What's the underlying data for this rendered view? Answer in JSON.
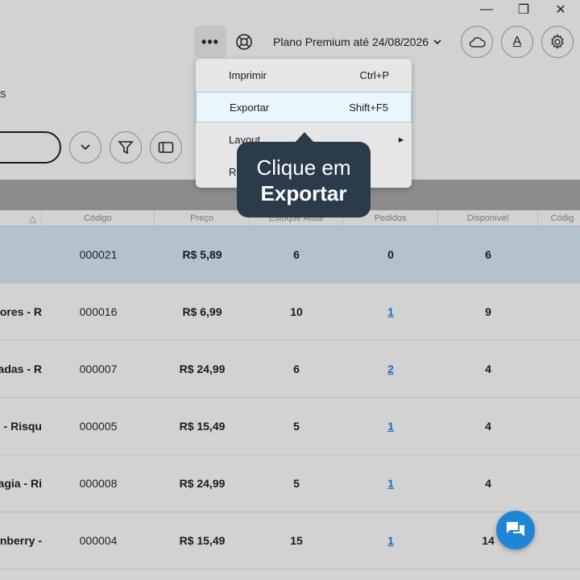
{
  "window": {
    "minimize_glyph": "—",
    "maximize_glyph": "❐",
    "close_glyph": "✕"
  },
  "topbar": {
    "more_glyph": "•••",
    "plan_text": "Plano Premium até 24/08/2026",
    "font_button_label": "A"
  },
  "toolbar": {
    "partial_label": "s"
  },
  "menu": {
    "items": [
      {
        "label": "Imprimir",
        "shortcut": "Ctrl+P"
      },
      {
        "label": "Exportar",
        "shortcut": "Shift+F5"
      },
      {
        "label": "Layout",
        "shortcut": ""
      },
      {
        "label": "Re",
        "shortcut": ""
      }
    ]
  },
  "tooltip": {
    "line1": "Clique em",
    "line2": "Exportar"
  },
  "table": {
    "sort_glyph": "△",
    "headers": [
      "Código",
      "Preço",
      "Estoque Atual",
      "Pedidos",
      "Disponível",
      "Códig"
    ],
    "rows": [
      {
        "name": "",
        "code": "000021",
        "price": "R$ 5,89",
        "stock": "6",
        "orders": "0",
        "avail": "6"
      },
      {
        "name": "ores - R",
        "code": "000016",
        "price": "R$ 6,99",
        "stock": "10",
        "orders": "1",
        "avail": "9"
      },
      {
        "name": "adas - R",
        "code": "000007",
        "price": "R$ 24,99",
        "stock": "6",
        "orders": "2",
        "avail": "4"
      },
      {
        "name": "- Risqu",
        "code": "000005",
        "price": "R$ 15,49",
        "stock": "5",
        "orders": "1",
        "avail": "4"
      },
      {
        "name": "agia - Ri",
        "code": "000008",
        "price": "R$ 24,99",
        "stock": "5",
        "orders": "1",
        "avail": "4"
      },
      {
        "name": "nberry -",
        "code": "000004",
        "price": "R$ 15,49",
        "stock": "15",
        "orders": "1",
        "avail": "14"
      }
    ]
  },
  "colors": {
    "accent": "#1f86d6",
    "selected_row": "#b3c2cc",
    "tooltip_bg": "#2c3b4a",
    "link": "#1a6bc4"
  },
  "icons": [
    "more-icon",
    "help-lifebuoy-icon",
    "chevron-down-icon",
    "cloud-icon",
    "font-icon",
    "gear-icon",
    "filter-icon",
    "panel-icon",
    "chat-icon"
  ]
}
